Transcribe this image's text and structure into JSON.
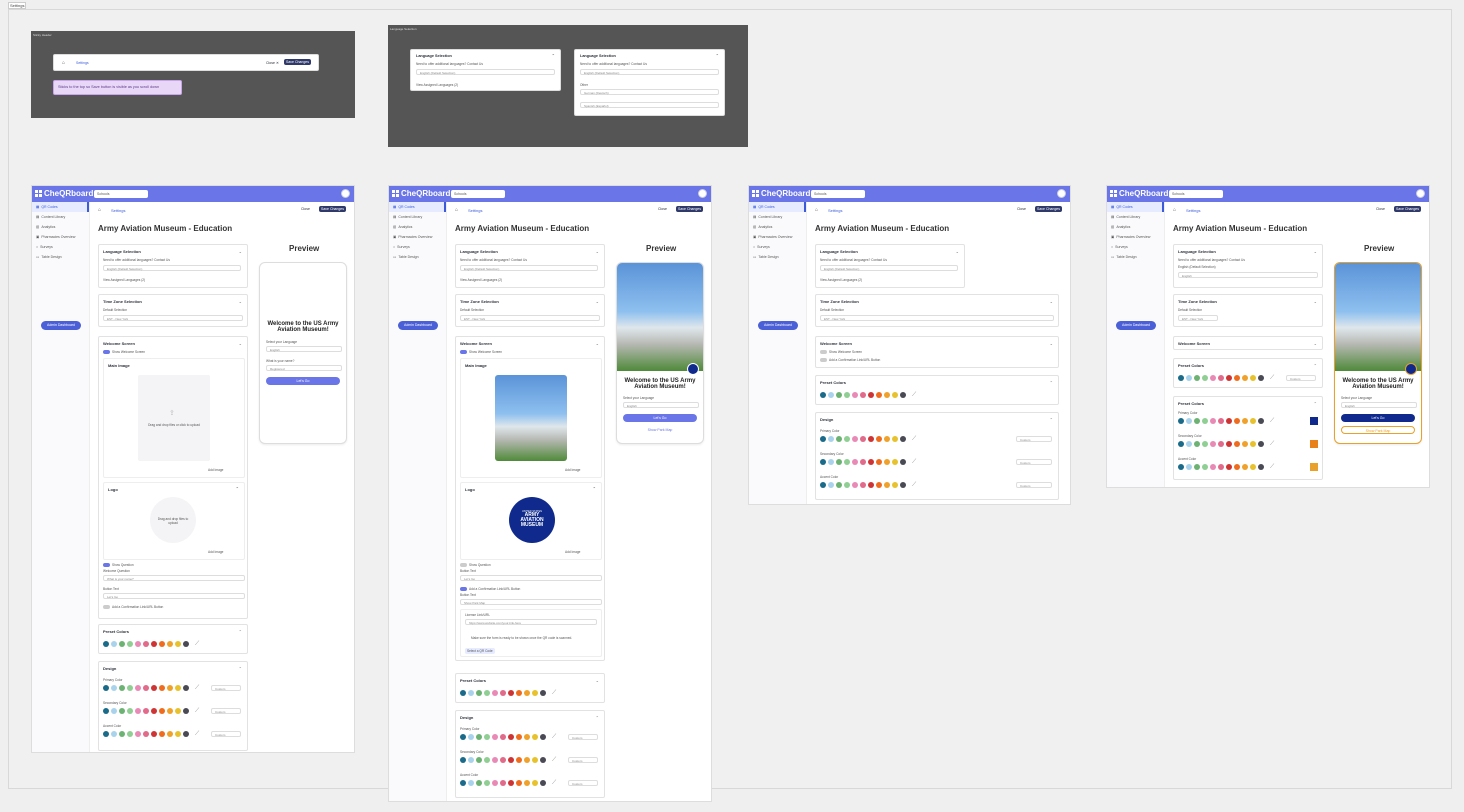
{
  "canvas": {
    "label": "Settings"
  },
  "frame_a": {
    "label": "Sticky Header",
    "breadcrumb": "Settings",
    "close": "Close",
    "save": "Save Changes",
    "note": "Sticks to the top so Save button is visible as you scroll down"
  },
  "frame_b": {
    "label": "Language Selection",
    "card_title": "Language Selection",
    "helper": "Need to offer additional languages? Contact Us",
    "primary_lang": "English (Default Selection)",
    "view_link": "View Assigned Languages (2)",
    "section_label": "Other",
    "lang_2": "German (Deutsch)",
    "lang_3": "Spanish (Español)"
  },
  "app": {
    "brand": "CheQRboard",
    "org": "Schools",
    "nav": [
      "QR Codes",
      "Content Library",
      "Analytics",
      "Pharmacies Overview",
      "Surveys",
      "Table Design"
    ],
    "admin_button": "Admin Dashboard",
    "breadcrumb": "Settings",
    "close": "Close",
    "save": "Save Changes",
    "page_title": "Army Aviation Museum - Education",
    "preview": "Preview",
    "language_card": "Language Selection",
    "language_helper": "Need to offer additional languages? Contact Us",
    "language_value": "English (Default Selection)",
    "language_link": "View Assigned Languages (2)",
    "timezone_card": "Time Zone Selection",
    "timezone_label": "Default Selection",
    "timezone_value": "EST - New York",
    "welcome_card": "Welcome Screen",
    "show_welcome": "Show Welcome Screen",
    "main_image": "Main Image",
    "upload_hint": "Drag and drop files or click to upload",
    "logo": "Logo",
    "logo_hint": "Drag and drop files to upload",
    "add_image": "Add Image",
    "show_question": "Show Question",
    "welcome_question": "Welcome Question",
    "question_placeholder": "What is your name?",
    "button_text": "Button Text",
    "button_placeholder": "Let's Go",
    "confirm_link": "Add a Confirmation Link/URL Button",
    "preset_colors": "Preset Colors",
    "design": "Design",
    "primary_color": "Primary Color",
    "secondary_color": "Secondary Color",
    "accent_color": "Accent Color",
    "custom": "Custom",
    "welcome_title": "Welcome to the US Army Aviation Museum!",
    "select_language": "Select your Language",
    "lang_english": "English",
    "your_name": "What is your name?",
    "name_placeholder": "Registered",
    "lets_go": "Let's Go",
    "show_park_map": "Show Park Map",
    "button_label_2": "Button Text",
    "show_map_field": "Show Park Map",
    "link_url": "License Link/URL",
    "link_placeholder": "https://www.website.com/your-link-here",
    "qr_note": "Make sure the form is ready to be shown once the QR code is scanned.",
    "select_qr": "Select a QR Code",
    "museum_name": "ARMY AVIATION MUSEUM",
    "museum_sub": "UNITED STATES"
  },
  "palette": [
    "#1a6b8a",
    "#a9d3ec",
    "#6cb373",
    "#8fcf93",
    "#e989b5",
    "#e26a8a",
    "#cf3434",
    "#ef6c1f",
    "#f0a12a",
    "#e8c22c",
    "#4a4a55"
  ],
  "colors": {
    "accent": "#6a76e8",
    "navy": "#0f2a8c",
    "gold": "#e8a12a"
  }
}
